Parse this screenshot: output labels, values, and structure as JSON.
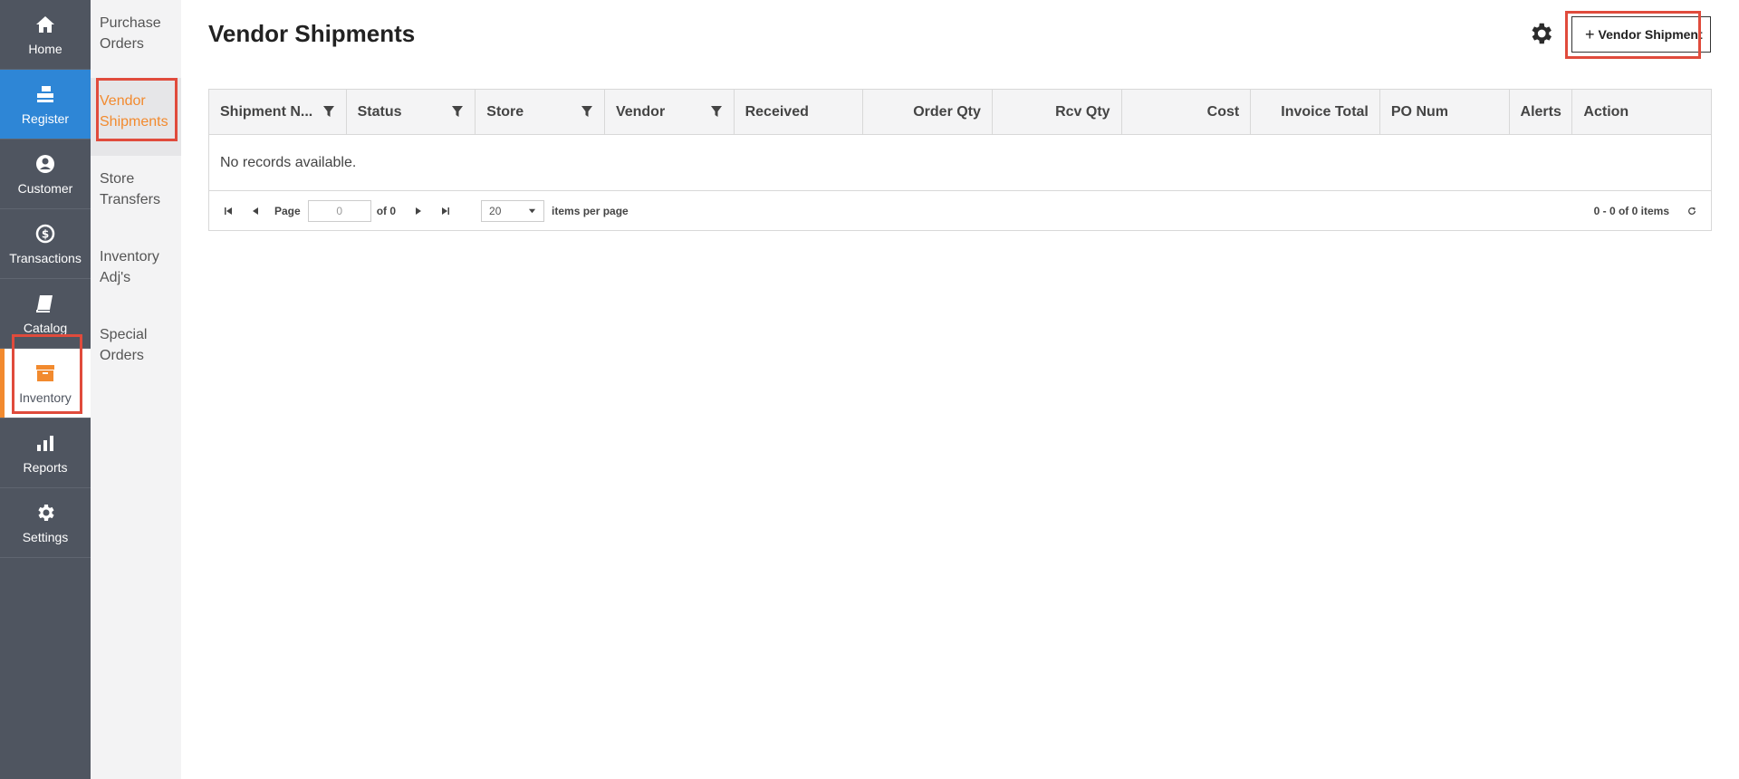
{
  "rail": {
    "items": [
      {
        "label": "Home",
        "icon": "home-icon"
      },
      {
        "label": "Register",
        "icon": "register-icon"
      },
      {
        "label": "Customer",
        "icon": "customer-icon"
      },
      {
        "label": "Transactions",
        "icon": "transactions-icon"
      },
      {
        "label": "Catalog",
        "icon": "catalog-icon"
      },
      {
        "label": "Inventory",
        "icon": "inventory-icon"
      },
      {
        "label": "Reports",
        "icon": "reports-icon"
      },
      {
        "label": "Settings",
        "icon": "settings-icon"
      }
    ]
  },
  "submenu": {
    "items": [
      {
        "label": "Purchase Orders"
      },
      {
        "label": "Vendor Shipments",
        "active": true
      },
      {
        "label": "Store Transfers"
      },
      {
        "label": "Inventory Adj's"
      },
      {
        "label": "Special Orders"
      }
    ]
  },
  "page": {
    "title": "Vendor Shipments",
    "add_button": "Vendor Shipment"
  },
  "grid": {
    "columns": [
      {
        "label": "Shipment N...",
        "filter": true
      },
      {
        "label": "Status",
        "filter": true
      },
      {
        "label": "Store",
        "filter": true
      },
      {
        "label": "Vendor",
        "filter": true
      },
      {
        "label": "Received"
      },
      {
        "label": "Order Qty"
      },
      {
        "label": "Rcv Qty"
      },
      {
        "label": "Cost"
      },
      {
        "label": "Invoice Total"
      },
      {
        "label": "PO Num"
      },
      {
        "label": "Alerts"
      },
      {
        "label": "Action"
      }
    ],
    "empty_text": "No records available.",
    "pager": {
      "page_label": "Page",
      "page_value": "0",
      "of_label": "of 0",
      "page_size": "20",
      "per_page_label": "items per page",
      "summary": "0 - 0 of 0 items"
    }
  },
  "colors": {
    "rail_bg": "#4f5560",
    "register_active": "#2e86d6",
    "accent_orange": "#f28a2e",
    "highlight_red": "#e04b3c"
  }
}
